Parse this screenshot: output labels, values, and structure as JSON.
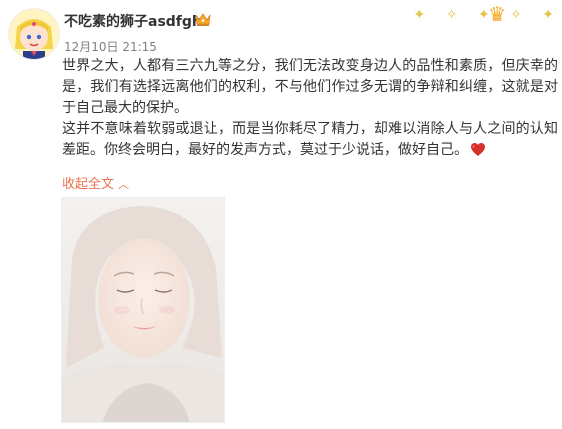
{
  "post": {
    "username": "不吃素的狮子asdfgh",
    "timestamp": "12月10日 21:15",
    "paragraphs": [
      "世界之大，人都有三六九等之分，我们无法改变身边人的品性和素质，但庆幸的是，我们有选择远离他们的权利，不与他们作过多无谓的争辩和纠缠，这就是对于自己最大的保护。",
      "这并不意味着软弱或退让，而是当你耗尽了精力，却难以消除人与人之间的认知差距。你终会明白，最好的发声方式，莫过于少说话，做好自己。"
    ],
    "collapse_label": "收起全文",
    "image_watermark": "·····",
    "badge_icon": "vip-crown-icon",
    "emoji_icon": "heart-icon"
  },
  "colors": {
    "link": "#eb7350",
    "heart": "#d9302c",
    "time": "#808080",
    "text": "#333333"
  }
}
